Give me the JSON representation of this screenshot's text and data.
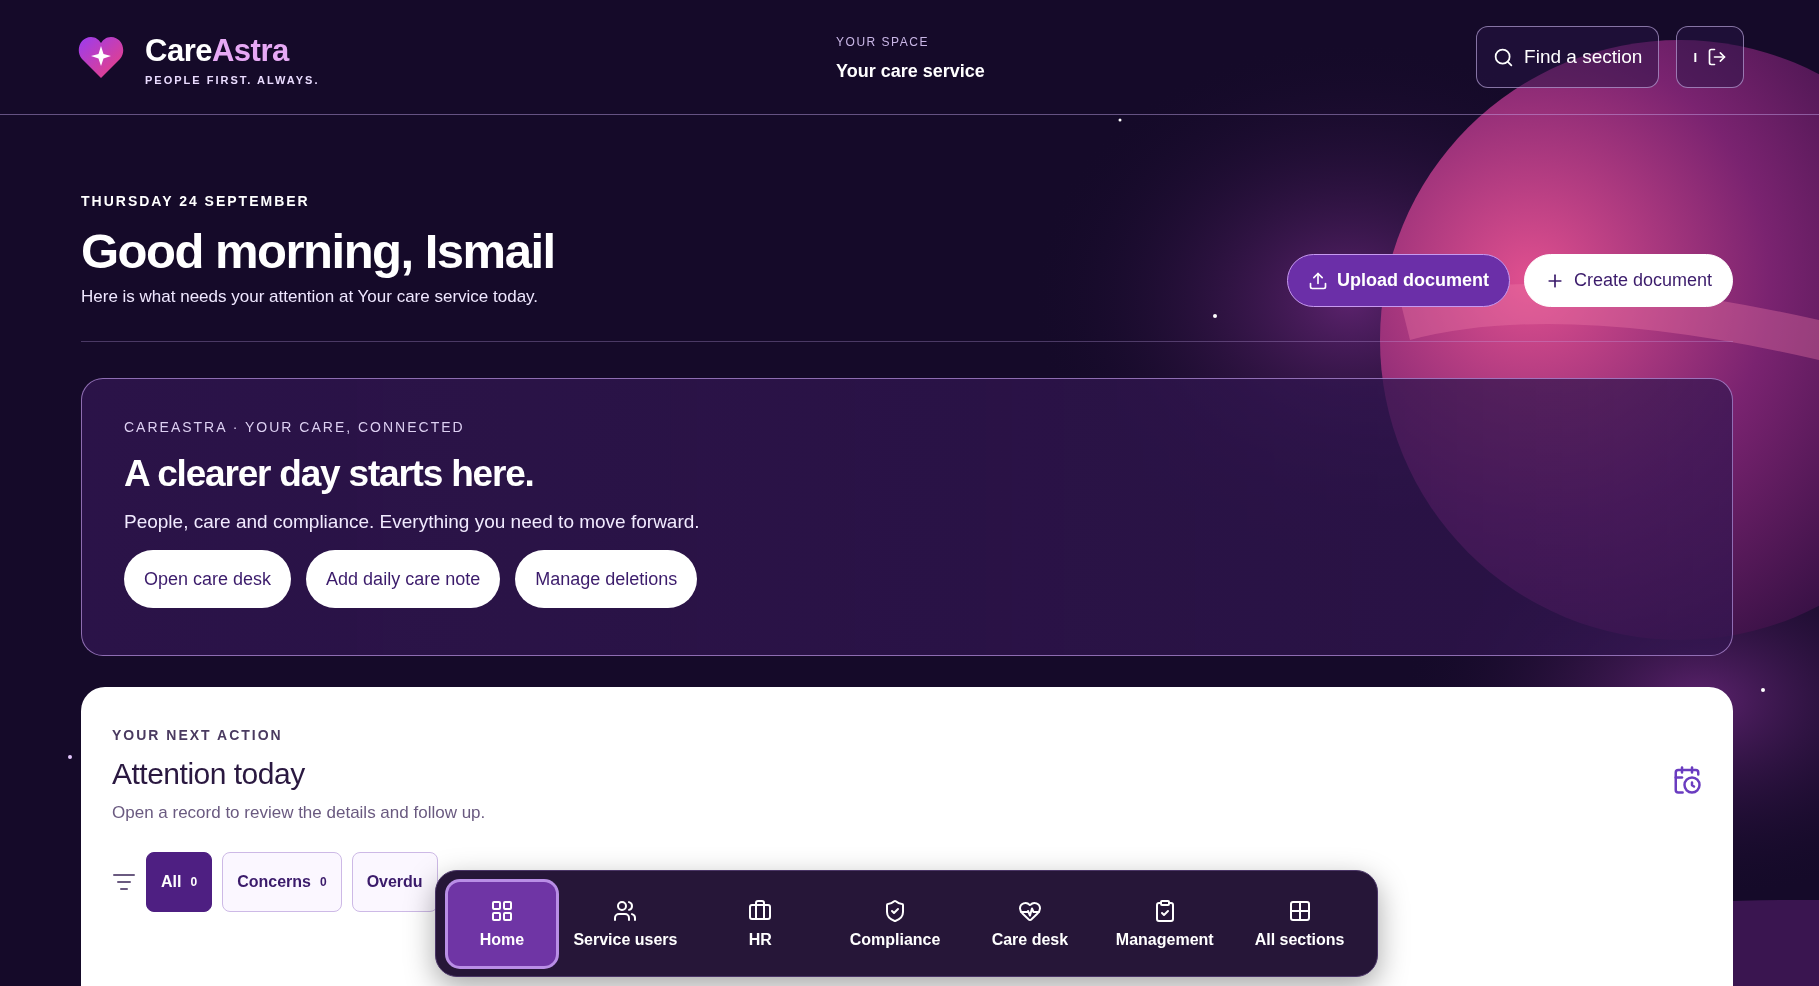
{
  "header": {
    "brand": {
      "first": "Care",
      "second": "Astra",
      "tagline": "PEOPLE FIRST. ALWAYS."
    },
    "space": {
      "label": "YOUR SPACE",
      "name": "Your care service"
    },
    "search_button": "Find a section",
    "account_initial": "I"
  },
  "hero": {
    "date": "THURSDAY 24 SEPTEMBER",
    "greeting": "Good morning, Ismail",
    "subtitle": "Here is what needs your attention at Your care service today.",
    "actions": [
      {
        "label": "Upload document",
        "kind": "primary"
      },
      {
        "label": "Create document",
        "kind": "secondary"
      }
    ]
  },
  "banner": {
    "eyebrow": "CAREASTRA · YOUR CARE, CONNECTED",
    "title": "A clearer day starts here.",
    "text": "People, care and compliance. Everything you need to move forward.",
    "buttons": [
      "Open care desk",
      "Add daily care note",
      "Manage deletions"
    ]
  },
  "attention": {
    "eyebrow": "YOUR NEXT ACTION",
    "title": "Attention today",
    "text": "Open a record to review the details and follow up.",
    "filters": [
      {
        "label": "All",
        "count": "0",
        "selected": true
      },
      {
        "label": "Concerns",
        "count": "0",
        "selected": false
      },
      {
        "label": "Overdu",
        "selected": false
      }
    ]
  },
  "bottom_nav": [
    {
      "label": "Home",
      "selected": true
    },
    {
      "label": "Service users",
      "selected": false
    },
    {
      "label": "HR",
      "selected": false
    },
    {
      "label": "Compliance",
      "selected": false
    },
    {
      "label": "Care desk",
      "selected": false
    },
    {
      "label": "Management",
      "selected": false
    },
    {
      "label": "All sections",
      "selected": false
    }
  ]
}
